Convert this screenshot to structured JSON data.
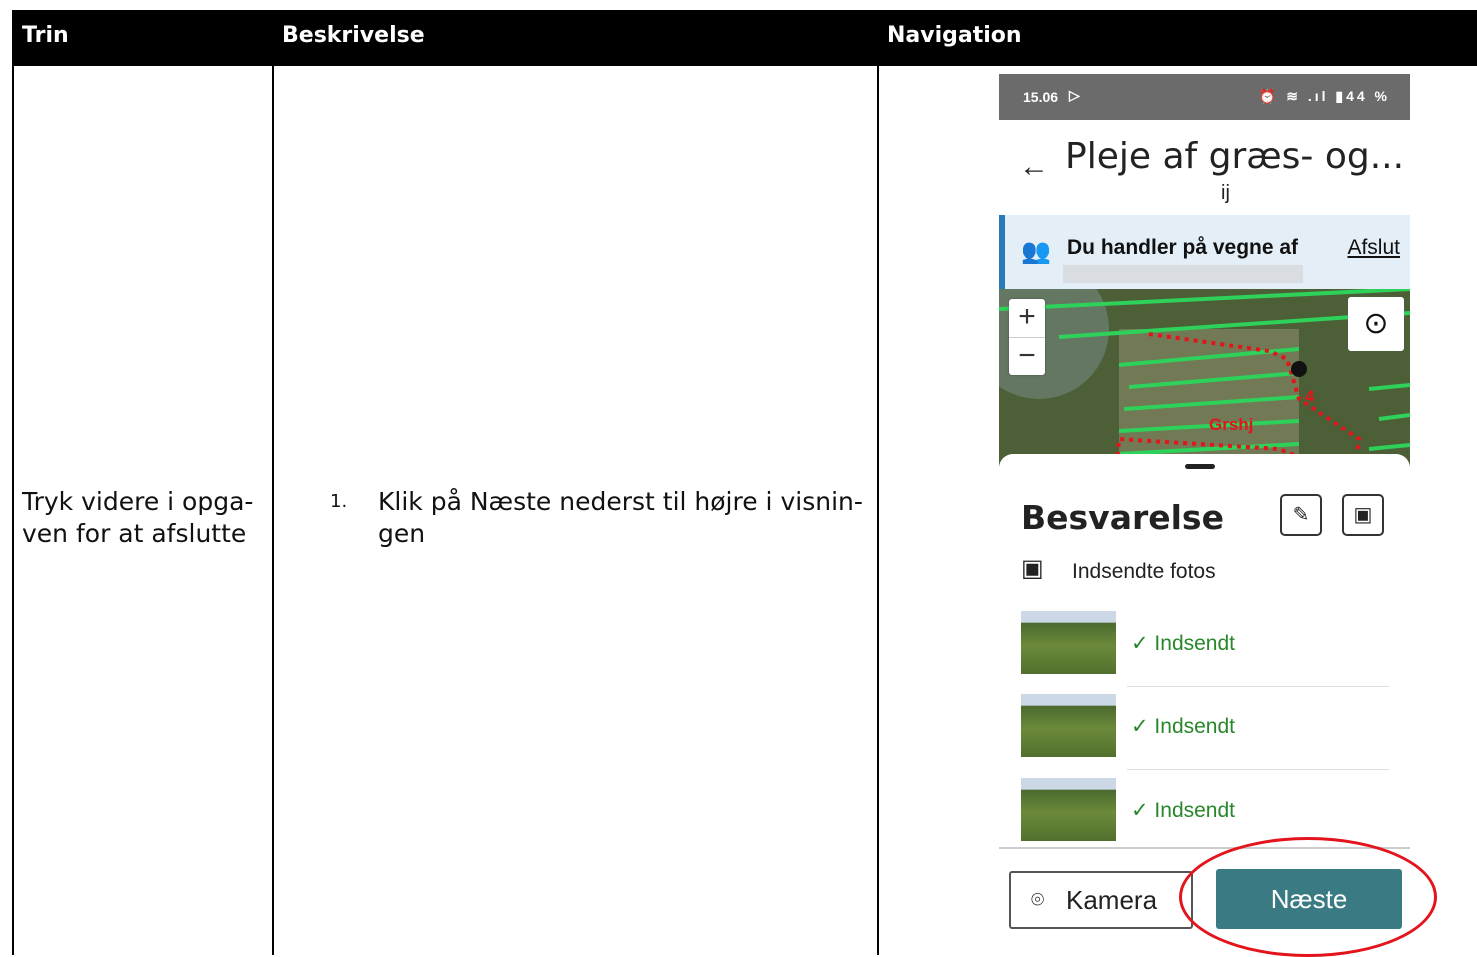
{
  "table": {
    "headers": [
      "Trin",
      "Beskrivelse",
      "Navigation"
    ],
    "row": {
      "step": [
        "Tryk videre i opga-",
        "ven for at afslutte"
      ],
      "list_number": "1.",
      "description": [
        "Klik på Næste nederst til højre i visnin-",
        "gen"
      ]
    }
  },
  "phone": {
    "status_bar": {
      "time": "15.06",
      "play_glyph": "▷",
      "right_icons": "⏰ ≋ .ıl ▮44 %"
    },
    "title": "Pleje af græs- og...",
    "subtitle": "ij",
    "banner": {
      "icon": "people-icon",
      "label": "Du handler på vegne af",
      "action": "Afslut"
    },
    "map": {
      "zoom_in": "+",
      "zoom_out": "−",
      "locate_icon": "locate-icon",
      "label_field": "Grshj",
      "label_number": "4",
      "colors": {
        "field_lines": "#2ed15a",
        "boundary": "#e5141b"
      }
    },
    "sheet": {
      "title": "Besvarelse",
      "edit_icon": "edit-icon",
      "gallery_icon": "gallery-icon",
      "photos_label": "Indsendte fotos",
      "items": [
        {
          "status": "✓ Indsendt"
        },
        {
          "status": "✓ Indsendt"
        },
        {
          "status": "✓ Indsendt"
        }
      ]
    },
    "bottom": {
      "camera_label": "Kamera",
      "next_label": "Næste",
      "accent": "#3a7a83"
    }
  },
  "annotation": {
    "highlight_color": "#e3141b"
  }
}
